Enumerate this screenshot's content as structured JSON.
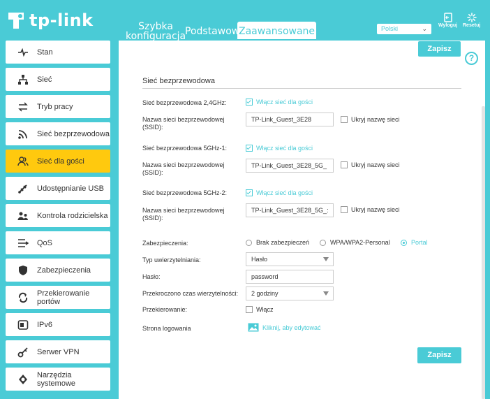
{
  "brand": {
    "logo_text": "tp-link"
  },
  "nav": {
    "tabs": [
      {
        "label_line1": "Szybka",
        "label_line2": "konfiguracja"
      },
      {
        "label": "Podstawowe"
      },
      {
        "label": "Zaawansowane"
      }
    ],
    "language": "Polski",
    "logout": "Wyloguj",
    "reset": "Resetuj"
  },
  "sidebar": {
    "items": [
      {
        "label": "Stan",
        "icon": "pulse-icon"
      },
      {
        "label": "Sieć",
        "icon": "network-icon"
      },
      {
        "label": "Tryb pracy",
        "icon": "mode-icon"
      },
      {
        "label": "Sieć bezprzewodowa",
        "icon": "wifi-icon"
      },
      {
        "label": "Sieć dla gości",
        "icon": "guests-icon"
      },
      {
        "label": "Udostępnianie USB",
        "icon": "usb-icon"
      },
      {
        "label": "Kontrola rodzicielska",
        "icon": "parental-icon"
      },
      {
        "label": "QoS",
        "icon": "qos-icon"
      },
      {
        "label": "Zabezpieczenia",
        "icon": "shield-icon"
      },
      {
        "label": "Przekierowanie",
        "label2": "portów",
        "icon": "forwarding-icon"
      },
      {
        "label": "IPv6",
        "icon": "ipv6-icon"
      },
      {
        "label": "Serwer VPN",
        "icon": "vpn-key-icon"
      },
      {
        "label": "Narzędzia systemowe",
        "icon": "tools-gear-icon"
      }
    ]
  },
  "main": {
    "save_top": "Zapisz",
    "save_bottom": "Zapisz",
    "section_title": "Sieć bezprzewodowa",
    "bands": [
      {
        "label": "Sieć bezprzewodowa 2,4GHz:",
        "enable_label": "Włącz sieć dla gości",
        "ssid_label_1": "Nazwa sieci bezprzewodowej",
        "ssid_label_2": "(SSID):",
        "ssid_value": "TP-Link_Guest_3E28",
        "hide_label": "Ukryj nazwę sieci"
      },
      {
        "label": "Sieć bezprzewodowa 5GHz-1:",
        "enable_label": "Włącz sieć dla gości",
        "ssid_label_1": "Nazwa sieci bezprzewodowej",
        "ssid_label_2": "(SSID):",
        "ssid_value": "TP-Link_Guest_3E28_5G_",
        "hide_label": "Ukryj nazwę sieci"
      },
      {
        "label": "Sieć bezprzewodowa 5GHz-2:",
        "enable_label": "Włącz sieć dla gości",
        "ssid_label_1": "Nazwa sieci bezprzewodowej",
        "ssid_label_2": "(SSID):",
        "ssid_value": "TP-Link_Guest_3E28_5G_:",
        "hide_label": "Ukryj nazwę sieci"
      }
    ],
    "security_label": "Zabezpieczenia:",
    "security_options": [
      "Brak zabezpieczeń",
      "WPA/WPA2-Personal",
      "Portal"
    ],
    "auth_type_label": "Typ uwierzytelniania:",
    "auth_type_value": "Hasło",
    "password_label": "Hasło:",
    "password_value": "password",
    "timeout_label": "Przekroczono czas wierzytelności:",
    "timeout_value": "2 godziny",
    "redirect_label": "Przekierowanie:",
    "redirect_enable": "Włącz",
    "login_page_label": "Strona logowania",
    "login_page_link": "Kliknij, aby edytować"
  },
  "colors": {
    "accent": "#4acbd6",
    "active_sidebar": "#ffc90e"
  }
}
